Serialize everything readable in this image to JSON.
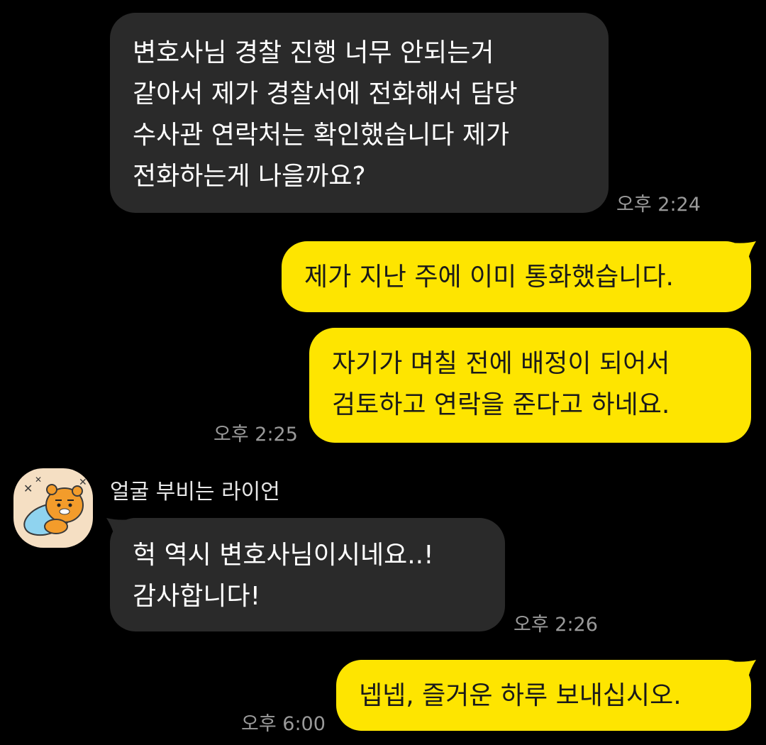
{
  "messages": [
    {
      "lines": [
        "변호사님 경찰 진행 너무 안되는거",
        "같아서 제가 경찰서에 전화해서 담당",
        "수사관 연락처는 확인했습니다 제가",
        "전화하는게 나을까요?"
      ],
      "time": "오후 2:24"
    },
    {
      "lines": [
        "제가 지난 주에 이미 통화했습니다."
      ]
    },
    {
      "lines": [
        "자기가 며칠 전에 배정이 되어서",
        "검토하고 연락을 준다고 하네요."
      ],
      "time": "오후 2:25"
    },
    {
      "sender": "얼굴 부비는 라이언",
      "lines": [
        "헉 역시 변호사님이시네요..!",
        "감사합니다!"
      ],
      "time": "오후 2:26"
    },
    {
      "lines": [
        "넵넵, 즐거운 하루 보내십시오."
      ],
      "time": "오후 6:00"
    }
  ],
  "colors": {
    "background": "#000000",
    "incoming_bubble": "#2a2a2a",
    "outgoing_bubble": "#fee500",
    "timestamp": "#9a9a9a"
  },
  "icons": {
    "avatar": "ryan-hugging-pillow-emoticon"
  }
}
